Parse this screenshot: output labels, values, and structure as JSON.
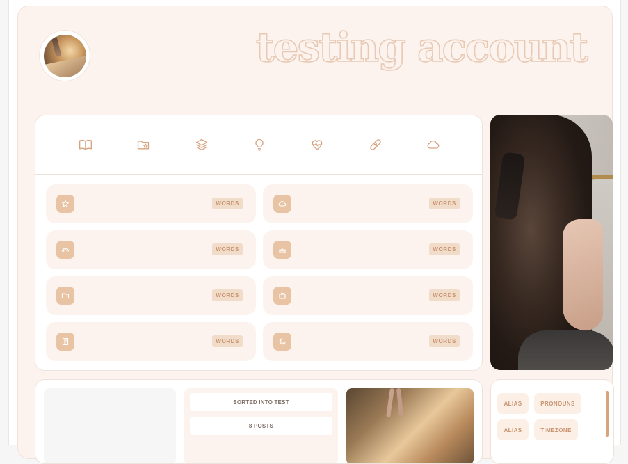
{
  "profile": {
    "display_name": "testing account"
  },
  "nav_icons": [
    {
      "name": "book-icon"
    },
    {
      "name": "folder-star-icon"
    },
    {
      "name": "layers-icon"
    },
    {
      "name": "lightbulb-icon"
    },
    {
      "name": "heartbeat-icon"
    },
    {
      "name": "bandage-icon"
    },
    {
      "name": "cloud-icon"
    }
  ],
  "link_tiles": [
    {
      "icon": "star-icon",
      "tag": "WORDS"
    },
    {
      "icon": "cloud-icon",
      "tag": "WORDS"
    },
    {
      "icon": "rainbow-icon",
      "tag": "WORDS"
    },
    {
      "icon": "cake-icon",
      "tag": "WORDS"
    },
    {
      "icon": "folder-icon",
      "tag": "WORDS"
    },
    {
      "icon": "bag-icon",
      "tag": "WORDS"
    },
    {
      "icon": "document-icon",
      "tag": "WORDS"
    },
    {
      "icon": "moon-icon",
      "tag": "WORDS"
    }
  ],
  "stats": {
    "sorted": "SORTED INTO TEST",
    "posts": "8 POSTS"
  },
  "info_chips": {
    "alias_1": "ALIAS",
    "pronouns": "PRONOUNS",
    "alias_2": "ALIAS",
    "timezone": "TIMEZONE"
  },
  "colors": {
    "card_bg": "#fcf3ee",
    "accent": "#c9936f",
    "tile_icon_bg": "#e8c4a4",
    "tag_bg": "#f1dcca",
    "scrollbar": "#d9a47a"
  }
}
